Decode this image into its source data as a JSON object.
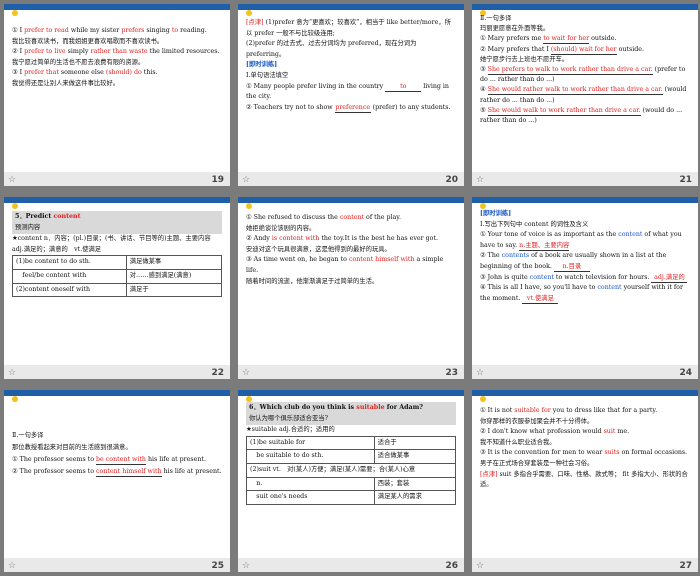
{
  "slides": [
    {
      "number": "19",
      "lines": [
        {
          "pre": "① I ",
          "red": "prefer to read",
          "post": " while my sister ",
          "red2": "prefers",
          "post2": " singing ",
          "red3": "to",
          "post3": " reading."
        },
        {
          "text": "我比较喜欢读书，而我姐姐更喜欢唱歌而不喜欢读书。"
        },
        {
          "pre": "② I ",
          "red": "prefer to live",
          "post": " simply ",
          "red2": "rather than waste",
          "post2": " the limited resources."
        },
        {
          "text": "我宁愿过简单的生活也不愿去浪费有限的资源。"
        },
        {
          "pre": "③ I ",
          "red": "prefer that",
          "post": " someone else ",
          "red2": "(should) do",
          "post2": " this."
        },
        {
          "text": "我觉得还是让别人来做这件事比较好。"
        }
      ]
    },
    {
      "number": "20",
      "lines": [
        {
          "tag": "[点津]",
          "text": " (1)prefer 意为“更喜欢；较喜欢”，相当于 like better/more，所以 prefer 一般不与比较级连用;"
        },
        {
          "text": "(2)prefer 的过去式、过去分词均为 preferred，现在分词为 preferring。"
        }
      ],
      "exercise": "[即时训练]",
      "ex_title": "Ⅰ.单句语法填空",
      "items": [
        {
          "pre": "① Many people prefer living in the country ",
          "ans": "to",
          "post": " living in the city."
        },
        {
          "pre": "② Teachers try not to show ",
          "ans": "preference",
          "post": " (prefer) to any students."
        }
      ]
    },
    {
      "number": "21",
      "title": "Ⅱ.一句多译",
      "cn": "玛丽更愿意在外面等我。",
      "items": [
        {
          "pre": "① Mary prefers me ",
          "ans": "to wait for her",
          "post": " outside."
        },
        {
          "pre": "② Mary prefers that I ",
          "ans": "(should) wait for her",
          "post": " outside."
        },
        {
          "text": "她宁愿步行去上班也不愿开车。"
        },
        {
          "pre": "③ ",
          "ans": "She prefers to walk to work rather than drive a car.",
          "post": " (prefer to do ... rather than do ...)"
        },
        {
          "pre": "④ ",
          "ans": "She would rather walk to work rather than drive a car.",
          "post": " (would rather do ... than do ...)"
        },
        {
          "pre": "⑤ ",
          "ans": "She would walk to work rather than drive a car.",
          "post": " (would do ... rather than do ...)"
        }
      ]
    },
    {
      "number": "22",
      "head": "5．Predict content",
      "sub": "预测内容",
      "def": "★content n．内容；(pl.)目录；(书、讲话、节目等的)主题、主要内容 adj.满足的；满意的　vt.使满足",
      "rows": [
        [
          "(1)be content to do sth.",
          "满足做某事"
        ],
        [
          "　feel/be content with",
          "对……感到满足(满意)"
        ],
        [
          "(2)content oneself with",
          "满足于"
        ]
      ]
    },
    {
      "number": "23",
      "lines": [
        {
          "pre": "① She refused to discuss the ",
          "red": "content",
          "post": " of the play."
        },
        {
          "text": "她拒绝谈论该剧的内容。"
        },
        {
          "pre": "② Andy ",
          "red": "is content with",
          "post": " the toy.It is the best he has ever got."
        },
        {
          "text": "安迪对这个玩具很满意，这是他得到的最好的玩具。"
        },
        {
          "pre": "③ As time went on, he began to ",
          "red": "content himself with",
          "post": " a simple life."
        },
        {
          "text": "随着时间的流逝，他渐渐满足于过简单的生活。"
        }
      ]
    },
    {
      "number": "24",
      "exercise": "[即时训练]",
      "title": "Ⅰ.写出下列句中 content 的词性及含义",
      "items": [
        {
          "pre": "① Your tone of voice is as important as the ",
          "blue": "content",
          "post": " of what you have to say.",
          "ans": "n.主题、主要内容"
        },
        {
          "pre": "② The ",
          "blue": "contents",
          "post": " of a book are usually shown in a list at the beginning of the book.",
          "ans": "n.目录"
        },
        {
          "pre": "③ John is quite ",
          "blue": "content",
          "post": " to watch television for hours.",
          "ans": "adj.满足的"
        },
        {
          "pre": "④ This is all I have, so you'll have to ",
          "blue": "content",
          "post": " yourself with it for the moment.",
          "ans": "vt.使满足"
        }
      ]
    },
    {
      "number": "25",
      "title": "Ⅱ.一句多译",
      "cn": "那位教授看起来对目前的生活感到很满意。",
      "items": [
        {
          "pre": "① The professor seems to ",
          "ans": "be content with",
          "post": " his life at present."
        },
        {
          "pre": "② The professor seems to ",
          "ans": "content himself with",
          "post": " his life at present."
        }
      ]
    },
    {
      "number": "26",
      "head": "6．Which club do you think is suitable for Adam?",
      "head_pre": "6．Which club do you think is ",
      "head_red": "suitable",
      "head_post": " for Adam?",
      "sub": "你认为哪个俱乐部适合亚当?",
      "def": "★suitable adj.合适的；适用的",
      "rows": [
        [
          "(1)be suitable for",
          "适合于"
        ],
        [
          "　be suitable to do sth.",
          "适合做某事"
        ],
        [
          "(2)suit vt.　对(某人)方便；满足(某人)需要；合(某人)心意",
          "　"
        ],
        [
          "　n.",
          "西装；套装"
        ],
        [
          "　suit one's needs",
          "满足某人的需求"
        ]
      ]
    },
    {
      "number": "27",
      "lines": [
        {
          "pre": "① It is not ",
          "red": "suitable for",
          "post": " you to dress like that for a party."
        },
        {
          "text": "你穿那样的衣服参加聚会并不十分得体。"
        },
        {
          "pre": "② I don't know what profession would ",
          "red": "suit",
          "post": " me."
        },
        {
          "text": "我不知道什么职业适合我。"
        },
        {
          "pre": "③ It is the convention for men to wear ",
          "red": "suits",
          "post": " on formal occasions."
        },
        {
          "text": "男子在正式场合穿套装是一种社会习俗。"
        }
      ],
      "tag": "[点津]",
      "note": " suit 多指合乎需要、口味、性格、款式等； fit 多指大小、形状的合适。"
    }
  ]
}
